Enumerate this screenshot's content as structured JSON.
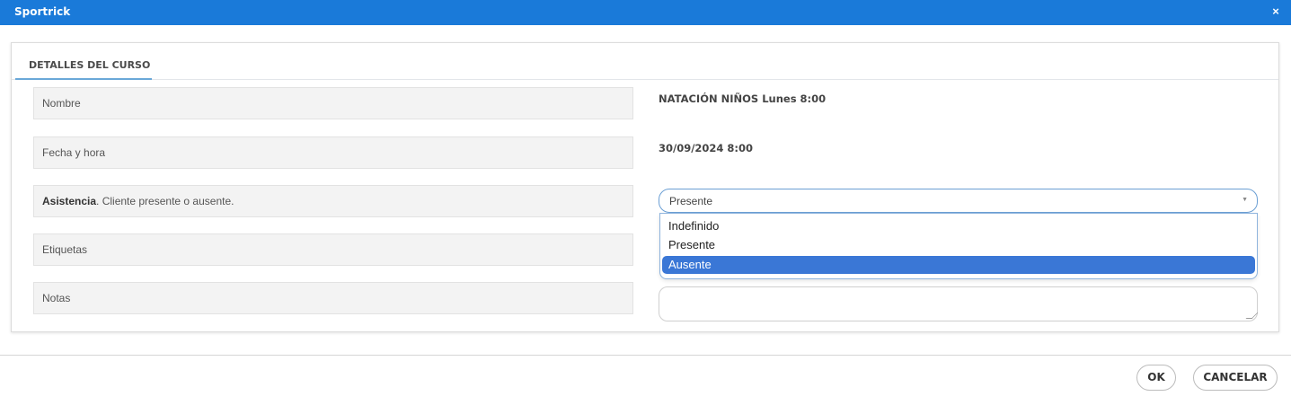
{
  "window": {
    "title": "Sportrick",
    "close_glyph": "×",
    "close_icon": "close-icon"
  },
  "tab": {
    "label": "DETALLES DEL CURSO"
  },
  "fields": {
    "nombre": {
      "label": "Nombre",
      "value": "NATACIÓN NIÑOS Lunes 8:00"
    },
    "fecha": {
      "label": "Fecha y hora",
      "value": "30/09/2024 8:00"
    },
    "asistencia": {
      "label_bold": "Asistencia",
      "label_rest": ". Cliente presente o ausente.",
      "selected": "Presente",
      "options": [
        "Indefinido",
        "Presente",
        "Ausente"
      ],
      "highlighted": "Ausente"
    },
    "etiquetas": {
      "label": "Etiquetas"
    },
    "notas": {
      "label": "Notas",
      "value": ""
    }
  },
  "buttons": {
    "ok": "OK",
    "cancel": "CANCELAR"
  },
  "colors": {
    "titlebar": "#1a7ad9",
    "highlight": "#3a77d6"
  }
}
